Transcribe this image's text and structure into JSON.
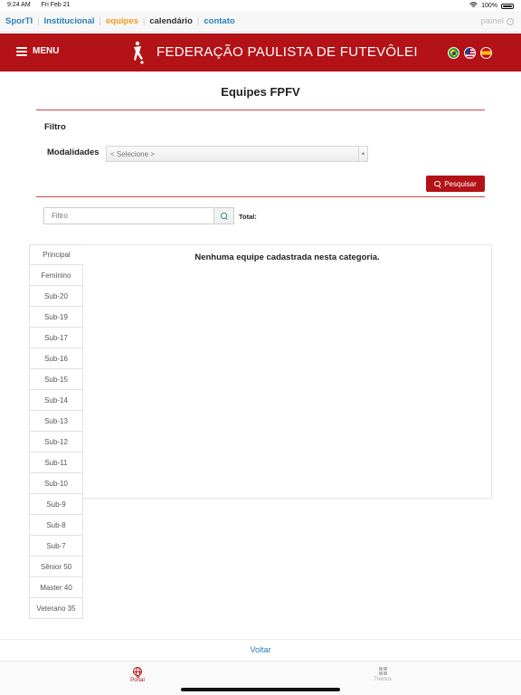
{
  "status": {
    "time": "9:24 AM",
    "date": "Fri Feb 21",
    "battery": "100%"
  },
  "topnav": {
    "links": [
      "SporTI",
      "Institucional",
      "equipes",
      "calendário",
      "contato"
    ],
    "painel": "painel"
  },
  "header": {
    "menu_label": "MENU",
    "federation_title": "FEDERAÇÃO PAULISTA DE FUTEVÔLEI"
  },
  "page": {
    "title": "Equipes FPFV"
  },
  "filter": {
    "label": "Filtro",
    "modalidades_label": "Modalidades",
    "modalidades_value": "< Selecione >",
    "search_button": "Pesquisar",
    "filter_placeholder": "Filtro",
    "total_label": "Total:"
  },
  "tabs": [
    "Principal",
    "Feminino",
    "Sub-20",
    "Sub-19",
    "Sub-17",
    "Sub-16",
    "Sub-15",
    "Sub-14",
    "Sub-13",
    "Sub-12",
    "Sub-11",
    "Sub-10",
    "Sub-9",
    "Sub-8",
    "Sub-7",
    "Sênior 50",
    "Master 40",
    "Veterano 35"
  ],
  "panel": {
    "message": "Nenhuma equipe cadastrada nesta categoria."
  },
  "footer": {
    "voltar": "Voltar"
  },
  "tabbar": {
    "portal": "Portal",
    "treinos": "Treinos"
  },
  "colors": {
    "brand_red": "#b31217",
    "link_blue": "#2a7fb8",
    "link_orange": "#f39b1e"
  }
}
